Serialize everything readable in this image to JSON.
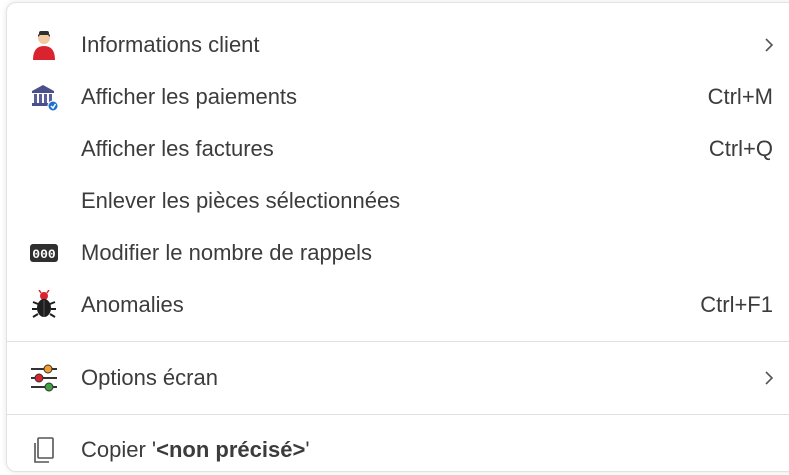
{
  "menu": {
    "items": [
      {
        "label": "Informations client",
        "shortcut": "",
        "icon": "customer-icon",
        "submenu": true
      },
      {
        "label": "Afficher les paiements",
        "shortcut": "Ctrl+M",
        "icon": "bank-icon",
        "submenu": false
      },
      {
        "label": "Afficher les factures",
        "shortcut": "Ctrl+Q",
        "icon": "",
        "submenu": false
      },
      {
        "label": "Enlever les pièces sélectionnées",
        "shortcut": "",
        "icon": "",
        "submenu": false
      },
      {
        "label": "Modifier le nombre de rappels",
        "shortcut": "",
        "icon": "counter-icon",
        "submenu": false
      },
      {
        "label": "Anomalies",
        "shortcut": "Ctrl+F1",
        "icon": "bug-icon",
        "submenu": false
      },
      {
        "label": "Options écran",
        "shortcut": "",
        "icon": "sliders-icon",
        "submenu": true
      }
    ],
    "copy_item": {
      "prefix": "Copier '",
      "value": "<non précisé>",
      "suffix": "'",
      "icon": "copy-icon"
    },
    "counter_glyph": "000"
  }
}
